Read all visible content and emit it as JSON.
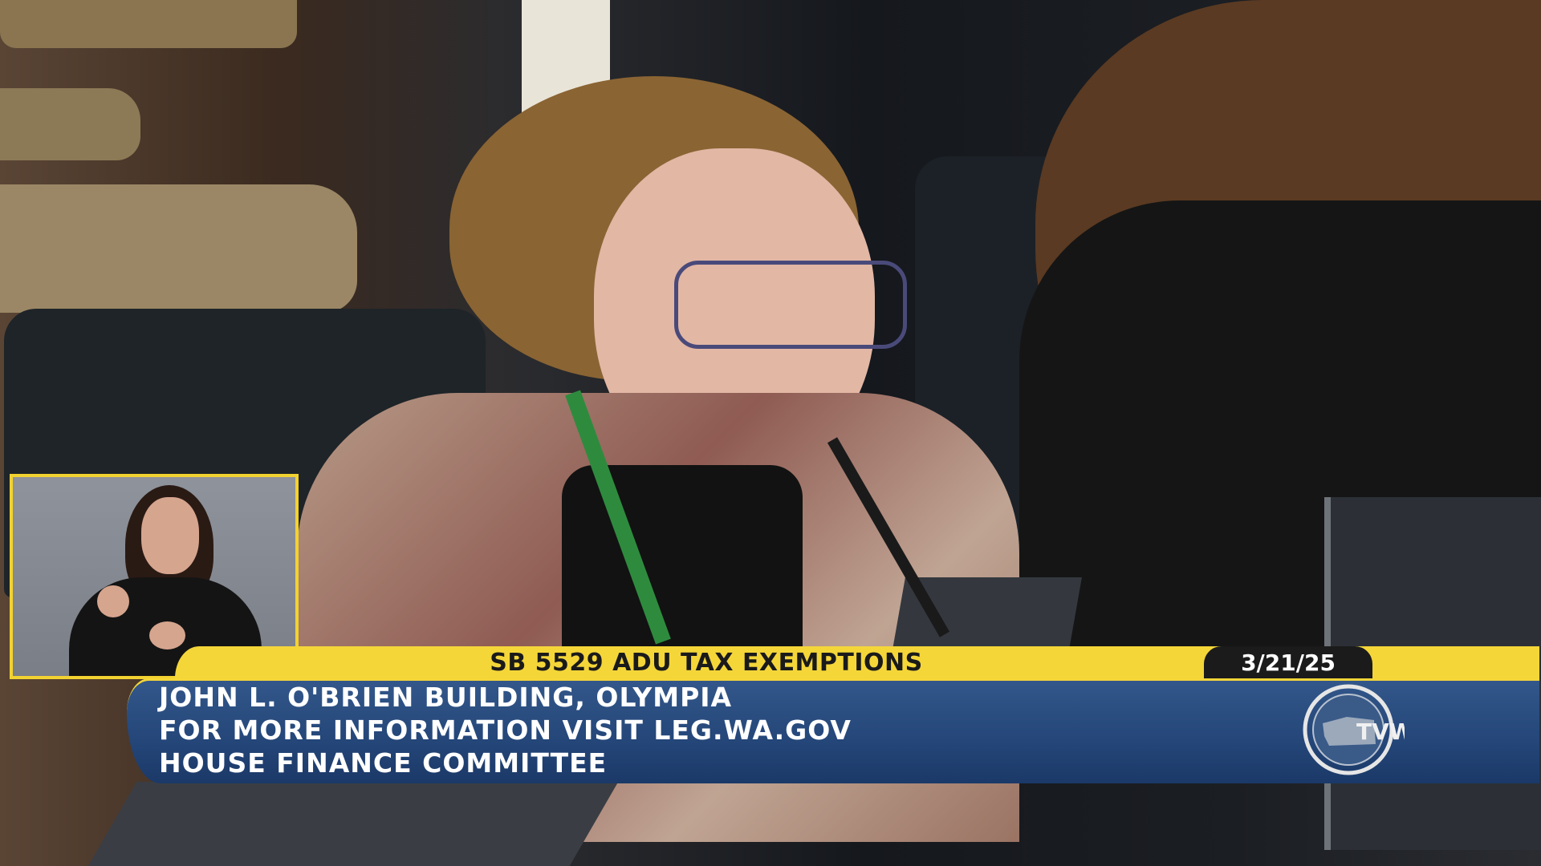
{
  "broadcast": {
    "topic": "SB 5529 ADU TAX EXEMPTIONS",
    "date": "3/21/25",
    "lines": [
      "JOHN L. O'BRIEN BUILDING, OLYMPIA",
      "FOR MORE INFORMATION VISIT LEG.WA.GOV",
      "HOUSE FINANCE COMMITTEE"
    ],
    "logo_text": "TVW"
  },
  "colors": {
    "accent_yellow": "#f4d639",
    "bar_blue": "#25477a",
    "date_black": "#1b1b1b"
  },
  "icons": [
    "tvw-logo-icon",
    "washington-state-icon"
  ]
}
